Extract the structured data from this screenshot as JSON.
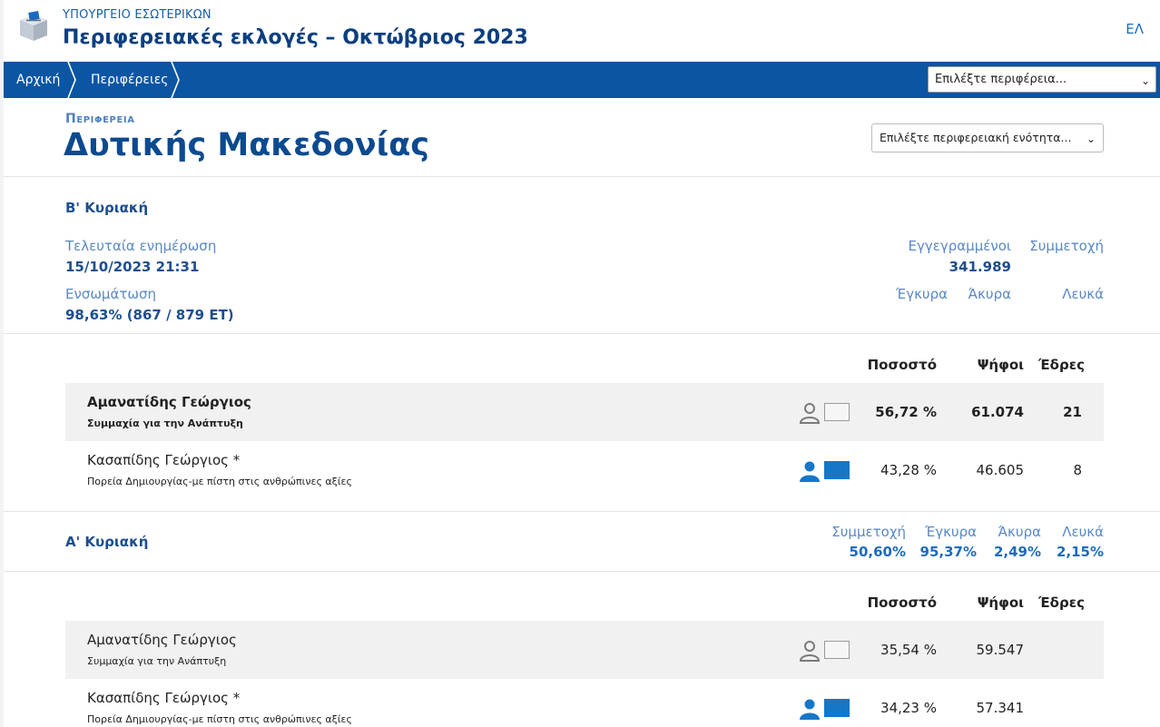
{
  "header": {
    "ministry": "ΥΠΟΥΡΓΕΙΟ ΕΣΩΤΕΡΙΚΩΝ",
    "title": "Περιφερειακές εκλογές – Οκτώβριος 2023",
    "lang": "ΕΛ",
    "logo_icon": "ballot-box-icon"
  },
  "nav": {
    "breadcrumbs": [
      "Αρχική",
      "Περιφέρειες"
    ],
    "region_select_placeholder": "Επιλέξτε περιφέρεια...",
    "bg_color": "#0b55a3"
  },
  "region": {
    "kicker": "Περιφερεια",
    "name": "Δυτικής Μακεδονίας",
    "unit_select_placeholder": "Επιλέξτε περιφερειακή ενότητα..."
  },
  "round_b": {
    "title": "Β' Κυριακή",
    "last_update_label": "Τελευταία ενημέρωση",
    "last_update_value": "15/10/2023 21:31",
    "integration_label": "Ενσωμάτωση",
    "integration_value": "98,63% (867 / 879 ΕΤ)",
    "registered_label": "Εγγεγραμμένοι",
    "registered_value": "341.989",
    "turnout_label": "Συμμετοχή",
    "valid_label": "Έγκυρα",
    "invalid_label": "Άκυρα",
    "blank_label": "Λευκά",
    "columns": {
      "pct": "Ποσοστό",
      "votes": "Ψήφοι",
      "seats": "Έδρες"
    },
    "candidates": [
      {
        "name": "Αμανατίδης Γεώργιος",
        "party": "Συμμαχία για την Ανάπτυξη",
        "pct": "56,72 %",
        "votes": "61.074",
        "seats": "21",
        "winner": true
      },
      {
        "name": "Κασαπίδης Γεώργιος *",
        "party": "Πορεία Δημιουργίας-με πίστη στις ανθρώπινες αξίες",
        "pct": "43,28 %",
        "votes": "46.605",
        "seats": "8",
        "winner": false
      }
    ]
  },
  "round_a": {
    "title": "Α' Κυριακή",
    "turnout_label": "Συμμετοχή",
    "turnout_value": "50,60%",
    "valid_label": "Έγκυρα",
    "valid_value": "95,37%",
    "invalid_label": "Άκυρα",
    "invalid_value": "2,49%",
    "blank_label": "Λευκά",
    "blank_value": "2,15%",
    "columns": {
      "pct": "Ποσοστό",
      "votes": "Ψήφοι",
      "seats": "Έδρες"
    },
    "candidates": [
      {
        "name": "Αμανατίδης Γεώργιος",
        "party": "Συμμαχία για την Ανάπτυξη",
        "pct": "35,54 %",
        "votes": "59.547"
      },
      {
        "name": "Κασαπίδης Γεώργιος *",
        "party": "Πορεία Δημιουργίας-με πίστη στις ανθρώπινες αξίες",
        "pct": "34,23 %",
        "votes": "57.341"
      }
    ]
  },
  "colors": {
    "accent": "#0b55a3",
    "candidate_blue": "#1677c8"
  }
}
